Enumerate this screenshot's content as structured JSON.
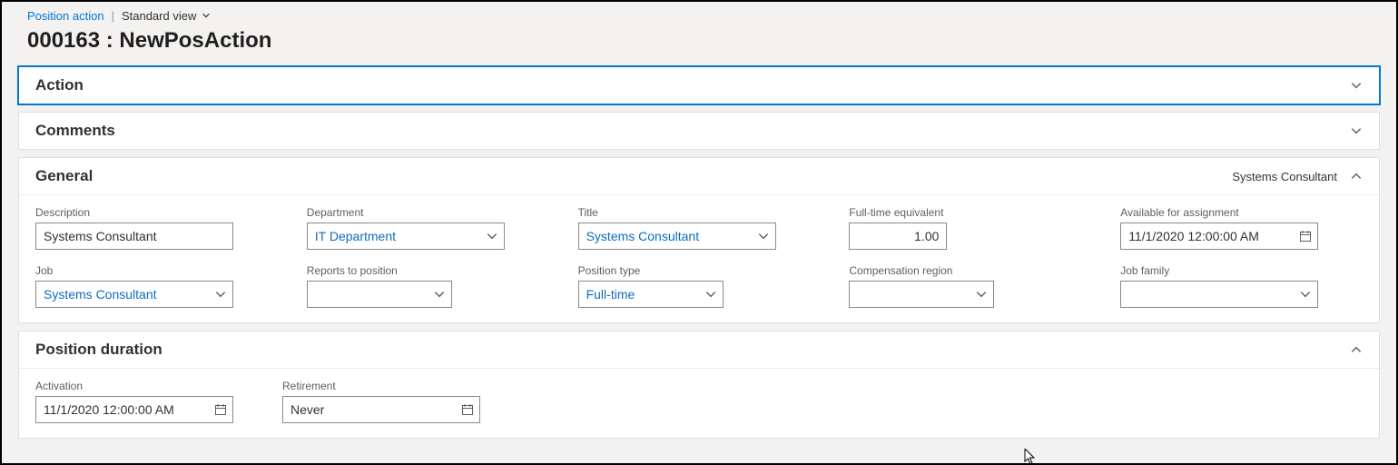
{
  "breadcrumb": {
    "module": "Position action",
    "view_label": "Standard view"
  },
  "page_title": "000163 : NewPosAction",
  "sections": {
    "action": {
      "title": "Action",
      "expanded": false
    },
    "comments": {
      "title": "Comments",
      "expanded": false
    },
    "general": {
      "title": "General",
      "expanded": true,
      "summary": "Systems Consultant"
    },
    "duration": {
      "title": "Position duration",
      "expanded": true
    }
  },
  "general": {
    "description": {
      "label": "Description",
      "value": "Systems Consultant"
    },
    "department": {
      "label": "Department",
      "value": "IT Department"
    },
    "title": {
      "label": "Title",
      "value": "Systems Consultant"
    },
    "fte": {
      "label": "Full-time equivalent",
      "value": "1.00"
    },
    "available": {
      "label": "Available for assignment",
      "value": "11/1/2020 12:00:00 AM"
    },
    "job": {
      "label": "Job",
      "value": "Systems Consultant"
    },
    "reports_to": {
      "label": "Reports to position",
      "value": ""
    },
    "pos_type": {
      "label": "Position type",
      "value": "Full-time"
    },
    "comp_region": {
      "label": "Compensation region",
      "value": ""
    },
    "job_family": {
      "label": "Job family",
      "value": ""
    }
  },
  "duration": {
    "activation": {
      "label": "Activation",
      "value": "11/1/2020 12:00:00 AM"
    },
    "retirement": {
      "label": "Retirement",
      "value": "Never"
    }
  }
}
